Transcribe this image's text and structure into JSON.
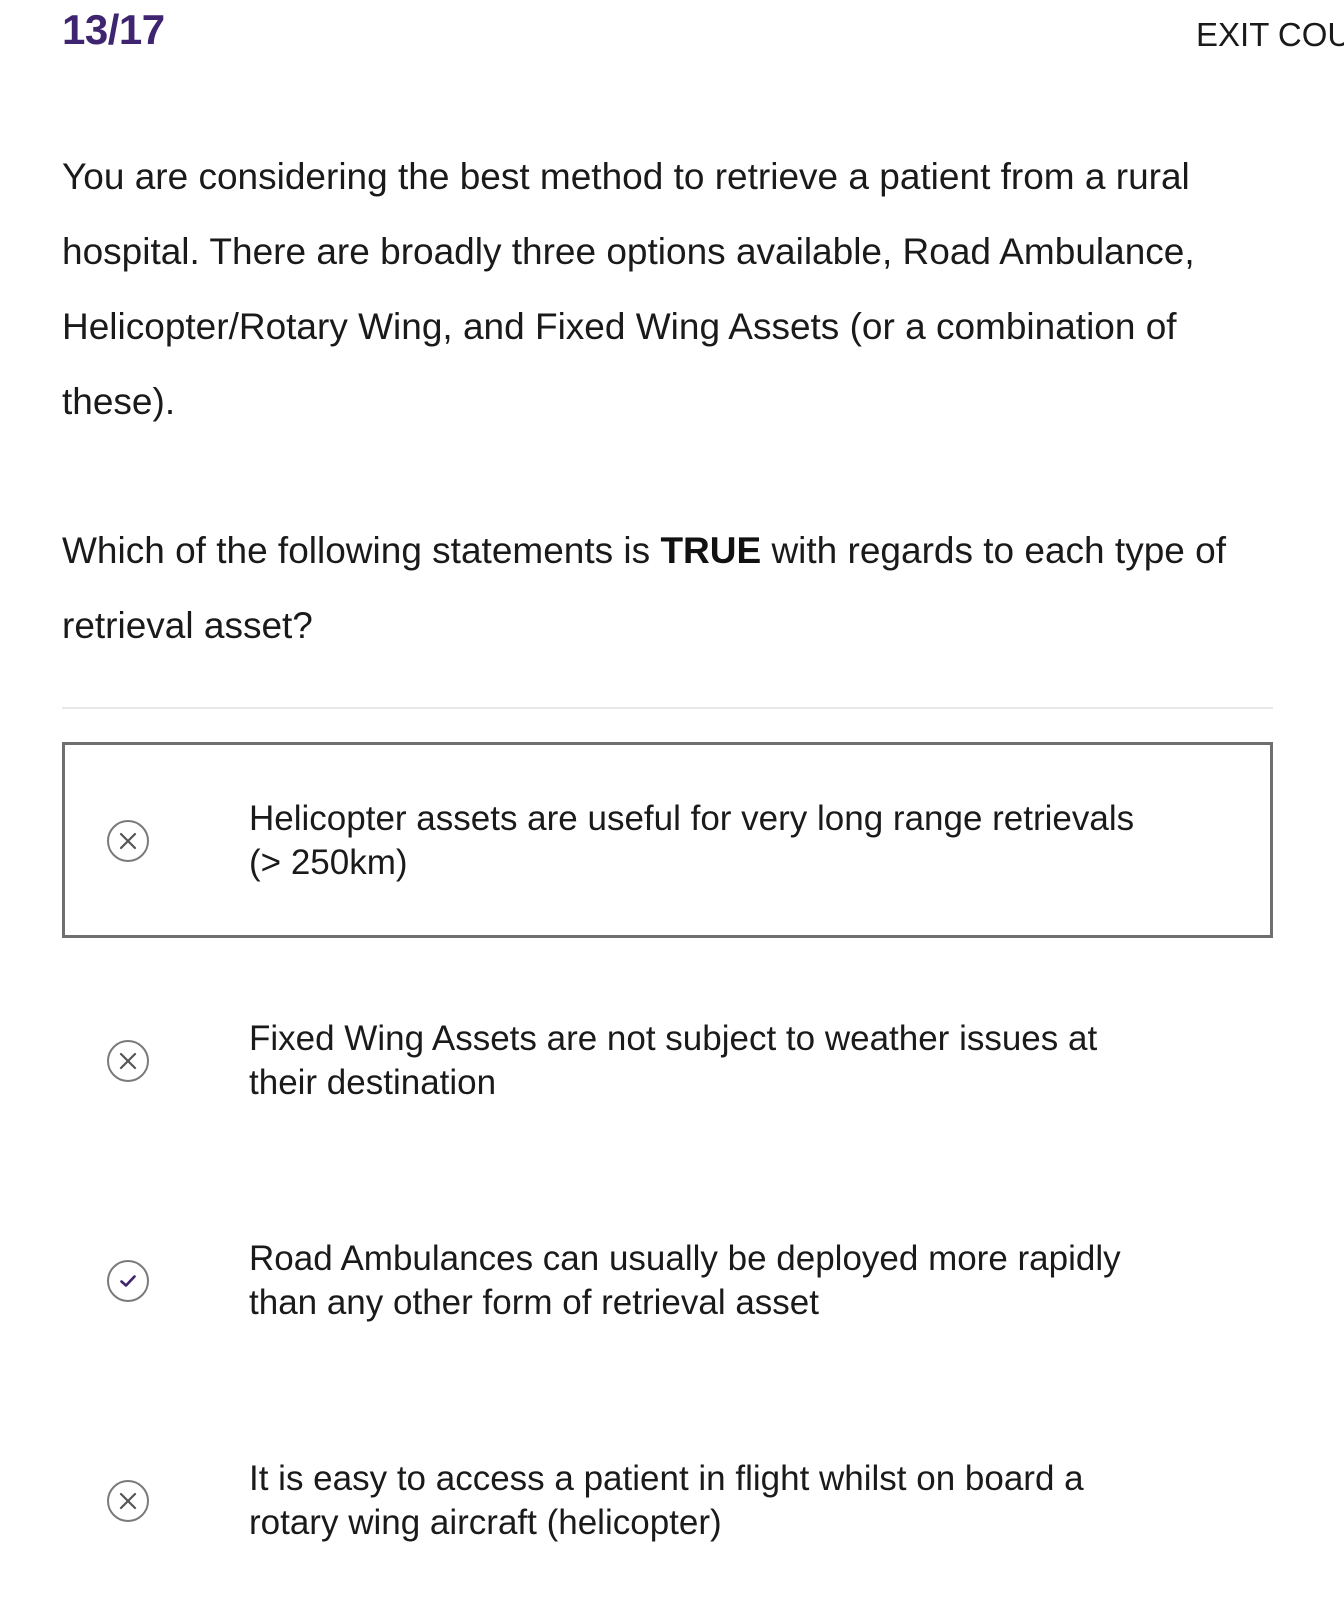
{
  "header": {
    "progress": "13/17",
    "exit_label": "EXIT COU"
  },
  "prompt": "You are considering the best method to retrieve a patient from a rural hospital. There are broadly three options available, Road Ambulance, Helicopter/Rotary Wing, and Fixed Wing Assets (or a combination of these).",
  "question": {
    "before": "Which of the following statements is ",
    "emphasis": "TRUE",
    "after": " with regards to each type of retrieval asset?"
  },
  "options": [
    {
      "text": "Helicopter assets are useful for very long range retrievals (> 250km)",
      "mark_icon": "cross-circle-icon",
      "selected": true
    },
    {
      "text": "Fixed Wing Assets are not subject to weather issues at their destination",
      "mark_icon": "cross-circle-icon",
      "selected": false
    },
    {
      "text": "Road Ambulances can usually be deployed more rapidly than any other form of retrieval asset",
      "mark_icon": "check-circle-icon",
      "selected": false
    },
    {
      "text": "It is easy to access a patient in flight whilst on board a rotary wing aircraft (helicopter)",
      "mark_icon": "cross-circle-icon",
      "selected": false
    }
  ],
  "colors": {
    "accent": "#3f2470",
    "cross": "#555555",
    "selected_border": "#6f6f6f",
    "divider": "#e8e8e8"
  }
}
